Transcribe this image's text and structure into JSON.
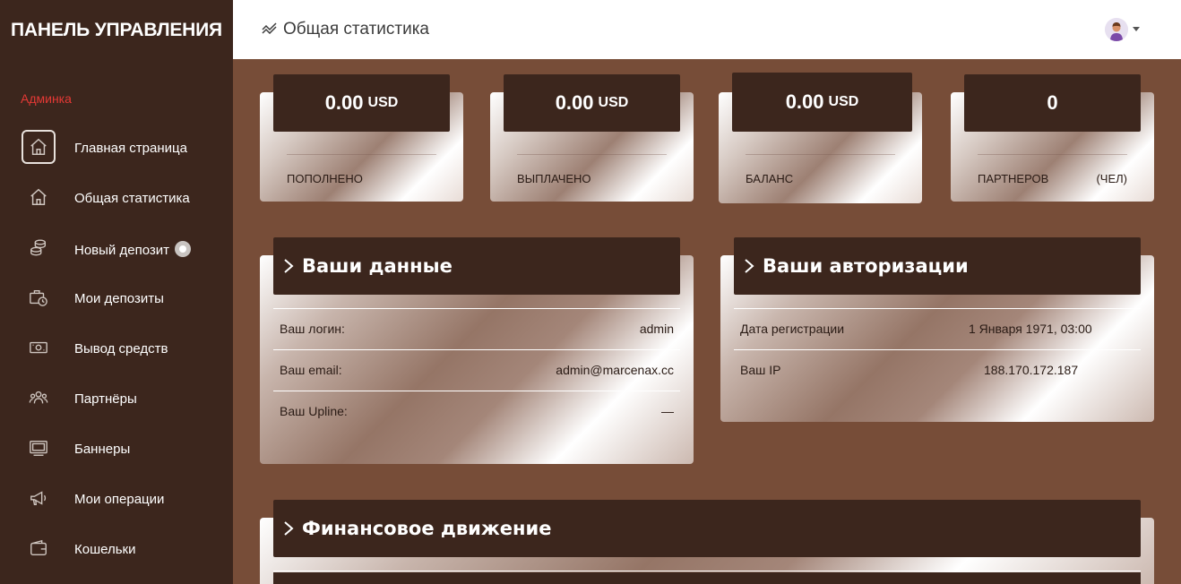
{
  "sidebar": {
    "brand": "ПАНЕЛЬ УПРАВЛЕНИЯ",
    "role_label": "Админка",
    "items": [
      {
        "label": "Главная страница",
        "icon": "home-icon",
        "active": true
      },
      {
        "label": "Общая статистика",
        "icon": "home-icon",
        "active": false
      },
      {
        "label": "Новый депозит",
        "icon": "coins-icon",
        "active": false
      },
      {
        "label": "Мои депозиты",
        "icon": "briefcase-clock-icon",
        "active": false
      },
      {
        "label": "Вывод средств",
        "icon": "money-icon",
        "active": false
      },
      {
        "label": "Партнёры",
        "icon": "users-icon",
        "active": false
      },
      {
        "label": "Баннеры",
        "icon": "banner-icon",
        "active": false
      },
      {
        "label": "Мои операции",
        "icon": "megaphone-icon",
        "active": false
      },
      {
        "label": "Кошельки",
        "icon": "wallet-icon",
        "active": false
      }
    ]
  },
  "topbar": {
    "title": "Общая статистика",
    "title_icon": "chart-line-icon"
  },
  "stats": [
    {
      "value": "0.00",
      "unit": "USD",
      "label": "ПОПОЛНЕНО",
      "unit_label": ""
    },
    {
      "value": "0.00",
      "unit": "USD",
      "label": "ВЫПЛАЧЕНО",
      "unit_label": ""
    },
    {
      "value": "0.00",
      "unit": "USD",
      "label": "БАЛАНС",
      "unit_label": ""
    },
    {
      "value": "0",
      "unit": "",
      "label": "ПАРТНЕРОВ",
      "unit_label": "(ЧЕЛ)"
    }
  ],
  "user_data": {
    "title": "Ваши данные",
    "rows": [
      {
        "key": "Ваш логин:",
        "value": "admin"
      },
      {
        "key": "Ваш email:",
        "value": "admin@marcenax.cc"
      },
      {
        "key": "Ваш Upline:",
        "value": "—"
      }
    ]
  },
  "auth_data": {
    "title": "Ваши авторизации",
    "rows": [
      {
        "key": "Дата регистрации",
        "value": "1 Января 1971, 03:00"
      },
      {
        "key": "Ваш IP",
        "value": "188.170.172.187"
      }
    ]
  },
  "finance": {
    "title": "Финансовое движение"
  },
  "colors": {
    "sidebar_bg": "#3c261d",
    "page_bg": "#774d38",
    "accent_red": "#e53935"
  }
}
